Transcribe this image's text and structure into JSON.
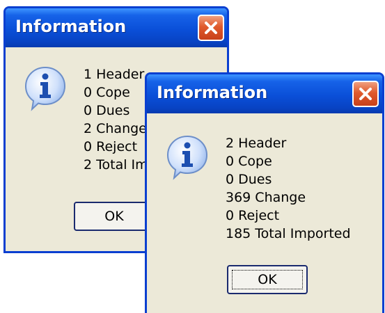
{
  "dialogs": [
    {
      "title": "Information",
      "icon": "information-icon",
      "lines": [
        "1 Header",
        "0 Cope",
        "0 Dues",
        "2 Change",
        "0 Reject",
        "2 Total Imported"
      ],
      "ok_label": "OK"
    },
    {
      "title": "Information",
      "icon": "information-icon",
      "lines": [
        "2 Header",
        "0 Cope",
        "0 Dues",
        "369 Change",
        "0 Reject",
        "185 Total Imported"
      ],
      "ok_label": "OK"
    }
  ],
  "colors": {
    "title_bar": "#0a4fd8",
    "dialog_face": "#ece9d8",
    "close_button": "#e05a2c"
  }
}
